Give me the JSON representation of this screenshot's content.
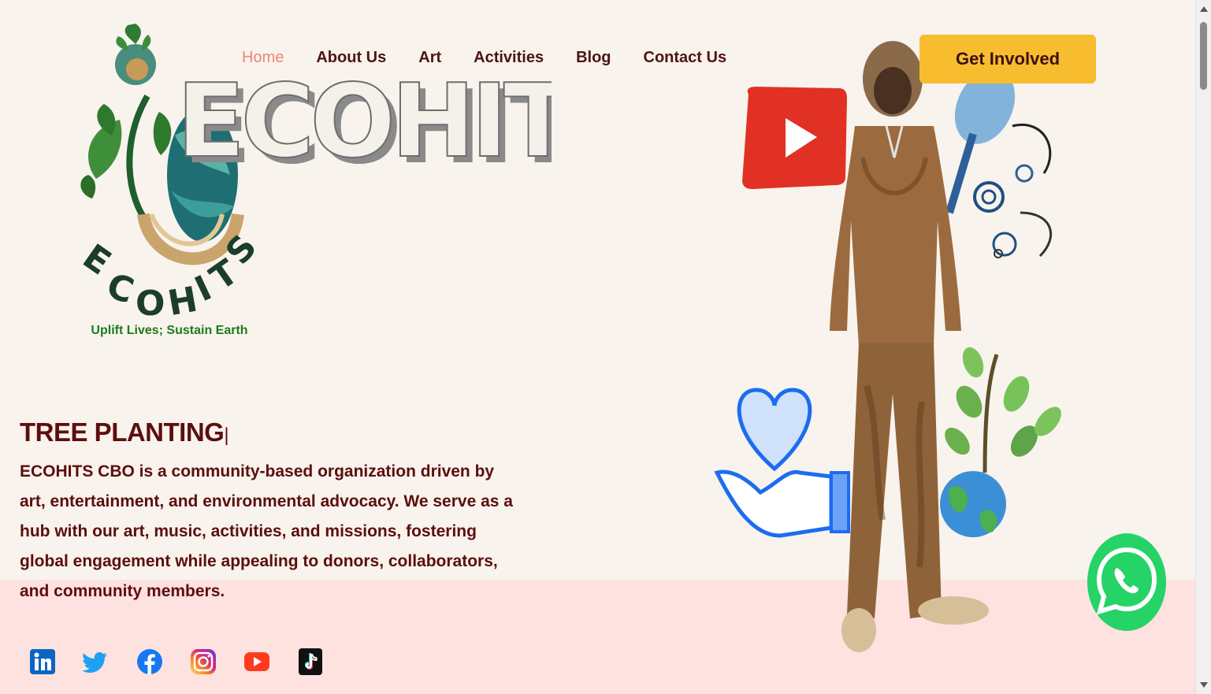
{
  "brand": {
    "logo_text": "ECOHITS",
    "wordmark": "ECOHITS",
    "tagline": "Uplift Lives; Sustain Earth"
  },
  "nav": {
    "items": [
      {
        "label": "Home",
        "active": true
      },
      {
        "label": "About Us",
        "active": false
      },
      {
        "label": "Art",
        "active": false
      },
      {
        "label": "Activities",
        "active": false
      },
      {
        "label": "Blog",
        "active": false
      },
      {
        "label": "Contact Us",
        "active": false
      }
    ],
    "cta_label": "Get Involved"
  },
  "hero": {
    "title": "TREE PLANTING",
    "caret": "|",
    "description": "ECOHITS CBO is a community-based organization driven by art, entertainment, and environmental advocacy. We serve as a hub with our art, music, activities, and missions, fostering global engagement while appealing to donors, collaborators, and community members."
  },
  "social": [
    {
      "name": "linkedin-icon",
      "color": "#0a66c2"
    },
    {
      "name": "twitter-icon",
      "color": "#1da1f2"
    },
    {
      "name": "facebook-icon",
      "color": "#1877f2"
    },
    {
      "name": "instagram-icon",
      "color": "#e1306c"
    },
    {
      "name": "youtube-icon",
      "color": "#ff0000"
    },
    {
      "name": "tiktok-icon",
      "color": "#111111"
    }
  ],
  "colors": {
    "background": "#f8f3ec",
    "band": "#fde2df",
    "accent": "#f8bd2e",
    "text": "#5c0e0e",
    "nav_active": "#f0857b",
    "whatsapp": "#25d366"
  }
}
